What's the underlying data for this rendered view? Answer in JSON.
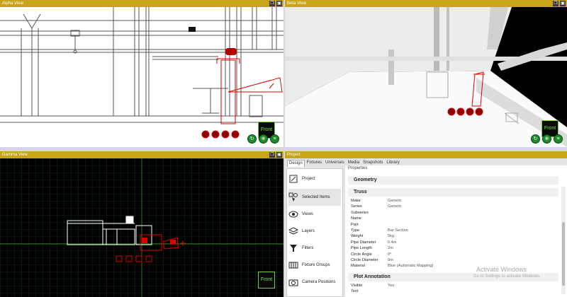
{
  "colors": {
    "title_bar": "#c8a418",
    "accent_red": "#e00000",
    "front_green": "#7ee04a",
    "grid_green": "#1b4d1b"
  },
  "panes": {
    "alpha": {
      "title": "Alpha View",
      "front_label": "Front"
    },
    "beta": {
      "title": "Beta View",
      "front_label": "Front"
    },
    "gamma": {
      "title": "Gamma View",
      "front_label": "Front"
    },
    "project": {
      "title": "Project"
    }
  },
  "project": {
    "tabs": [
      "Design",
      "Fixtures",
      "Universes",
      "Media",
      "Snapshots",
      "Library"
    ],
    "active_tab": "Design",
    "sidebar": [
      {
        "label": "Project",
        "icon": "project-icon"
      },
      {
        "label": "Selected Items",
        "icon": "selected-items-icon"
      },
      {
        "label": "Views",
        "icon": "eye-icon"
      },
      {
        "label": "Layers",
        "icon": "layers-icon"
      },
      {
        "label": "Filters",
        "icon": "filter-icon"
      },
      {
        "label": "Fixture Groups",
        "icon": "fixture-groups-icon"
      },
      {
        "label": "Camera Positions",
        "icon": "camera-icon"
      }
    ],
    "properties_label": "Properties",
    "sections": {
      "geometry": "Geometry",
      "truss": "Truss",
      "plot": "Plot Annotation"
    },
    "truss_rows": [
      {
        "key": "Make",
        "value": "Generic"
      },
      {
        "key": "Series",
        "value": "Generic"
      },
      {
        "key": "Subseries",
        "value": ""
      },
      {
        "key": "Name",
        "value": ""
      },
      {
        "key": "Part",
        "value": ""
      },
      {
        "key": "Type",
        "value": "Bar Section"
      },
      {
        "key": "Weight",
        "value": "5kg"
      },
      {
        "key": "Pipe Diameter",
        "value": "0.4m"
      },
      {
        "key": "Pipe Length",
        "value": "2m"
      },
      {
        "key": "Circle Angle",
        "value": "0°"
      },
      {
        "key": "Circle Diameter",
        "value": "0m"
      },
      {
        "key": "Material",
        "value": "Blue (Automatic Mapping)"
      }
    ],
    "plot_rows": [
      {
        "key": "Visible",
        "value": "Yes"
      },
      {
        "key": "Text",
        "value": ""
      }
    ]
  },
  "watermark": {
    "line1": "Activate Windows",
    "line2": "Go to Settings to activate Windows."
  }
}
